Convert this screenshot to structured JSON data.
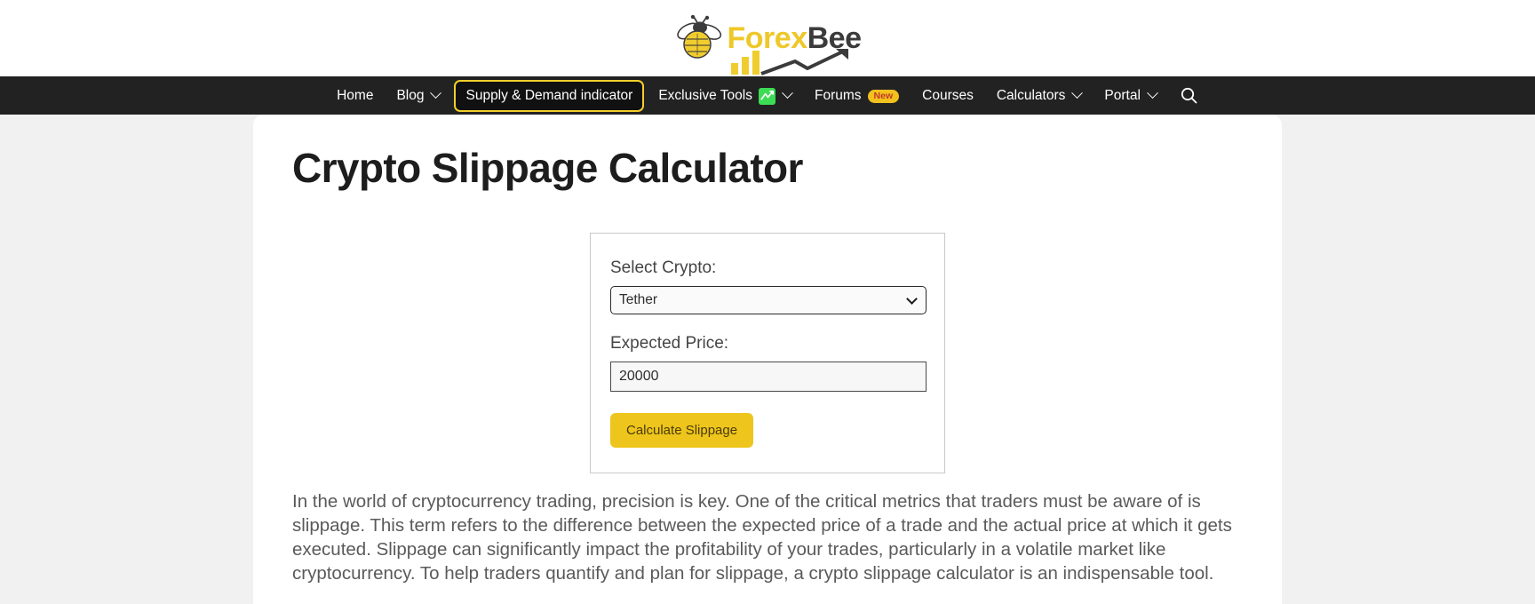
{
  "brand": {
    "name_part1": "Forex",
    "name_part2": "Bee",
    "logo_icon": "bee-icon",
    "chart_icon": "bar-chart-arrow-icon",
    "accent_color": "#eec82a",
    "dark_color": "#3b3b3b"
  },
  "nav": {
    "background_color": "#222222",
    "highlight_border_color": "#f3cf2a",
    "items": [
      {
        "label": "Home",
        "has_caret": false,
        "highlighted": false
      },
      {
        "label": "Blog",
        "has_caret": true,
        "highlighted": false
      },
      {
        "label": "Supply & Demand indicator",
        "has_caret": false,
        "highlighted": true
      },
      {
        "label": "Exclusive Tools",
        "has_caret": true,
        "highlighted": false,
        "emoji": "chart-increasing-emoji"
      },
      {
        "label": "Forums",
        "has_caret": false,
        "highlighted": false,
        "badge": "New"
      },
      {
        "label": "Courses",
        "has_caret": false,
        "highlighted": false
      },
      {
        "label": "Calculators",
        "has_caret": true,
        "highlighted": false
      },
      {
        "label": "Portal",
        "has_caret": true,
        "highlighted": false
      }
    ],
    "search_icon": "search-icon"
  },
  "main": {
    "title": "Crypto Slippage Calculator",
    "paragraph": "In the world of cryptocurrency trading, precision is key. One of the critical metrics that traders must be aware of is slippage. This term refers to the difference between the expected price of a trade and the actual price at which it gets executed. Slippage can significantly impact the profitability of your trades, particularly in a volatile market like cryptocurrency. To help traders quantify and plan for slippage, a crypto slippage calculator is an indispensable tool."
  },
  "calculator": {
    "select_label": "Select Crypto:",
    "select_value": "Tether",
    "select_options": [
      "Tether"
    ],
    "price_label": "Expected Price:",
    "price_value": "20000",
    "price_placeholder": "",
    "button_label": "Calculate Slippage",
    "button_color": "#eec51c",
    "dropdown_icon": "chevron-down-icon"
  }
}
